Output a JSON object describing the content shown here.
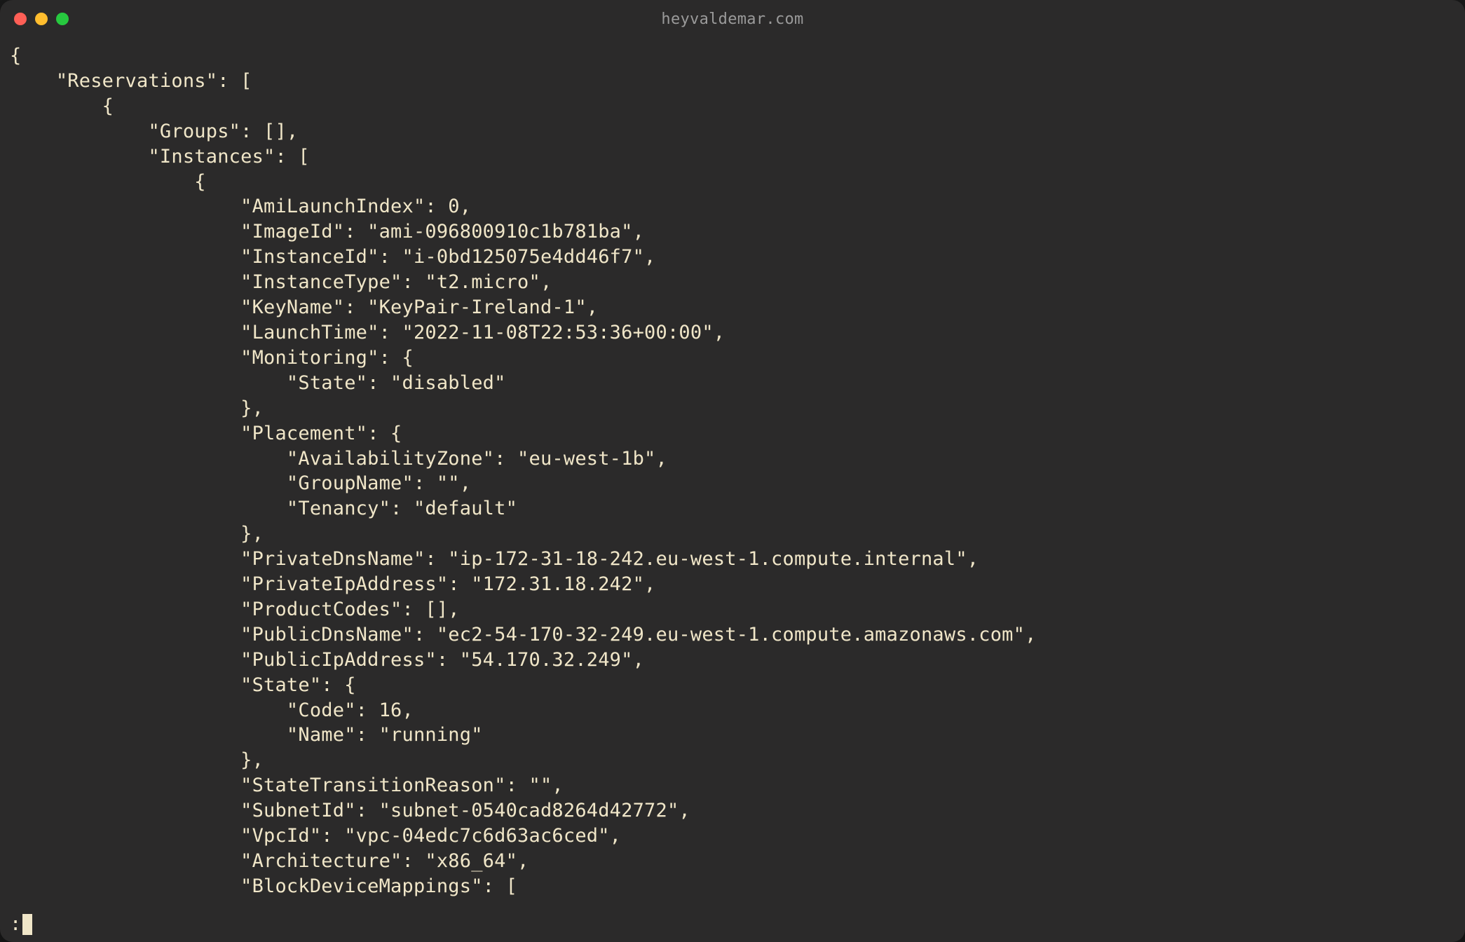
{
  "window": {
    "title": "heyvaldemar.com"
  },
  "terminal": {
    "json_output": {
      "Reservations": [
        {
          "Groups": [],
          "Instances": [
            {
              "AmiLaunchIndex": 0,
              "ImageId": "ami-096800910c1b781ba",
              "InstanceId": "i-0bd125075e4dd46f7",
              "InstanceType": "t2.micro",
              "KeyName": "KeyPair-Ireland-1",
              "LaunchTime": "2022-11-08T22:53:36+00:00",
              "Monitoring": {
                "State": "disabled"
              },
              "Placement": {
                "AvailabilityZone": "eu-west-1b",
                "GroupName": "",
                "Tenancy": "default"
              },
              "PrivateDnsName": "ip-172-31-18-242.eu-west-1.compute.internal",
              "PrivateIpAddress": "172.31.18.242",
              "ProductCodes": [],
              "PublicDnsName": "ec2-54-170-32-249.eu-west-1.compute.amazonaws.com",
              "PublicIpAddress": "54.170.32.249",
              "State": {
                "Code": 16,
                "Name": "running"
              },
              "StateTransitionReason": "",
              "SubnetId": "subnet-0540cad8264d42772",
              "VpcId": "vpc-04edc7c6d63ac6ced",
              "Architecture": "x86_64",
              "BlockDeviceMappings_open": "["
            }
          ]
        }
      ]
    },
    "prompt": ":"
  }
}
